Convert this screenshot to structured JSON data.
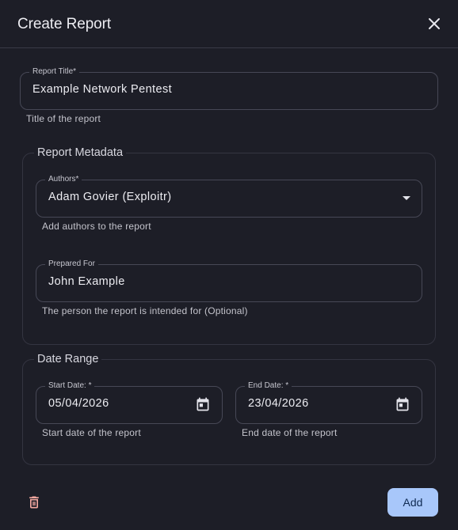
{
  "dialog": {
    "title": "Create Report"
  },
  "report_title": {
    "label": "Report Title*",
    "value": "Example Network Pentest",
    "helper": "Title of the report"
  },
  "metadata": {
    "legend": "Report Metadata",
    "authors": {
      "label": "Authors*",
      "value": "Adam Govier (Exploitr)",
      "helper": "Add authors to the report"
    },
    "prepared_for": {
      "label": "Prepared For",
      "value": "John Example",
      "helper": "The person the report is intended for (Optional)"
    }
  },
  "date_range": {
    "legend": "Date Range",
    "start": {
      "label": "Start Date: *",
      "value": "05/04/2026",
      "helper": "Start date of the report"
    },
    "end": {
      "label": "End Date: *",
      "value": "23/04/2026",
      "helper": "End date of the report"
    }
  },
  "footer": {
    "add_label": "Add"
  },
  "icons": {
    "close": "close-icon",
    "dropdown": "chevron-down-icon",
    "calendar": "calendar-icon",
    "delete": "trash-icon"
  },
  "colors": {
    "background": "#1d1e27",
    "accent": "#a8c7fa",
    "danger": "#f2a8a0"
  }
}
